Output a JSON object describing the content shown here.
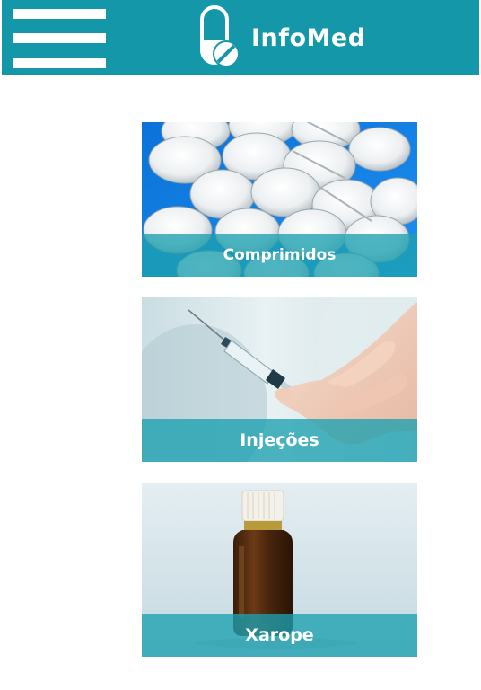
{
  "header": {
    "app_name": "InfoMed",
    "menu_icon": "hamburger-menu-icon",
    "logo_icon": "pill-icon",
    "color": "#1497a8"
  },
  "categories": [
    {
      "label": "Comprimidos",
      "image": "white-tablets-photo"
    },
    {
      "label": "Injeções",
      "image": "syringe-in-hand-photo"
    },
    {
      "label": "Xarope",
      "image": "amber-syrup-bottle-photo"
    }
  ]
}
